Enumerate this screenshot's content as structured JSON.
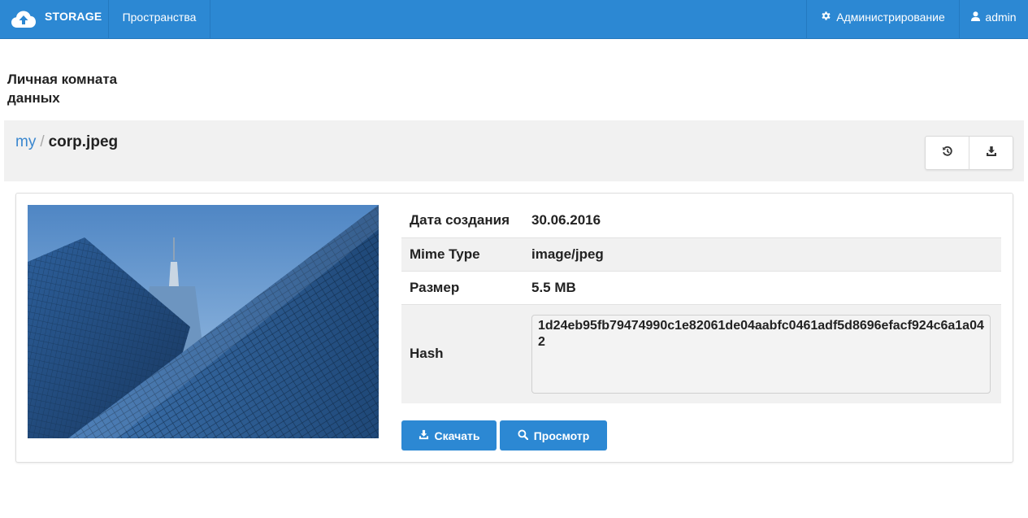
{
  "navbar": {
    "brand": "STORAGE",
    "brand_icon": "cloud-upload-icon",
    "spaces": "Пространства",
    "admin": "Администрирование",
    "admin_icon": "gear-icon",
    "user": "admin",
    "user_icon": "user-icon",
    "color": "#2c88d3"
  },
  "page": {
    "title": "Личная комната данных"
  },
  "breadcrumb": {
    "root": "my",
    "separator": "/",
    "current": "corp.jpeg"
  },
  "toolbar": {
    "history_icon": "history-icon",
    "download_icon": "download-icon"
  },
  "file": {
    "preview_alt": "corp.jpeg",
    "fields": [
      {
        "label": "Дата создания",
        "value": "30.06.2016"
      },
      {
        "label": "Mime Type",
        "value": "image/jpeg"
      },
      {
        "label": "Размер",
        "value": "5.5 MB"
      }
    ],
    "hash_label": "Hash",
    "hash_value": "1d24eb95fb79474990c1e82061de04aabfc0461adf5d8696efacf924c6a1a042"
  },
  "actions": {
    "download": "Скачать",
    "view": "Просмотр"
  }
}
